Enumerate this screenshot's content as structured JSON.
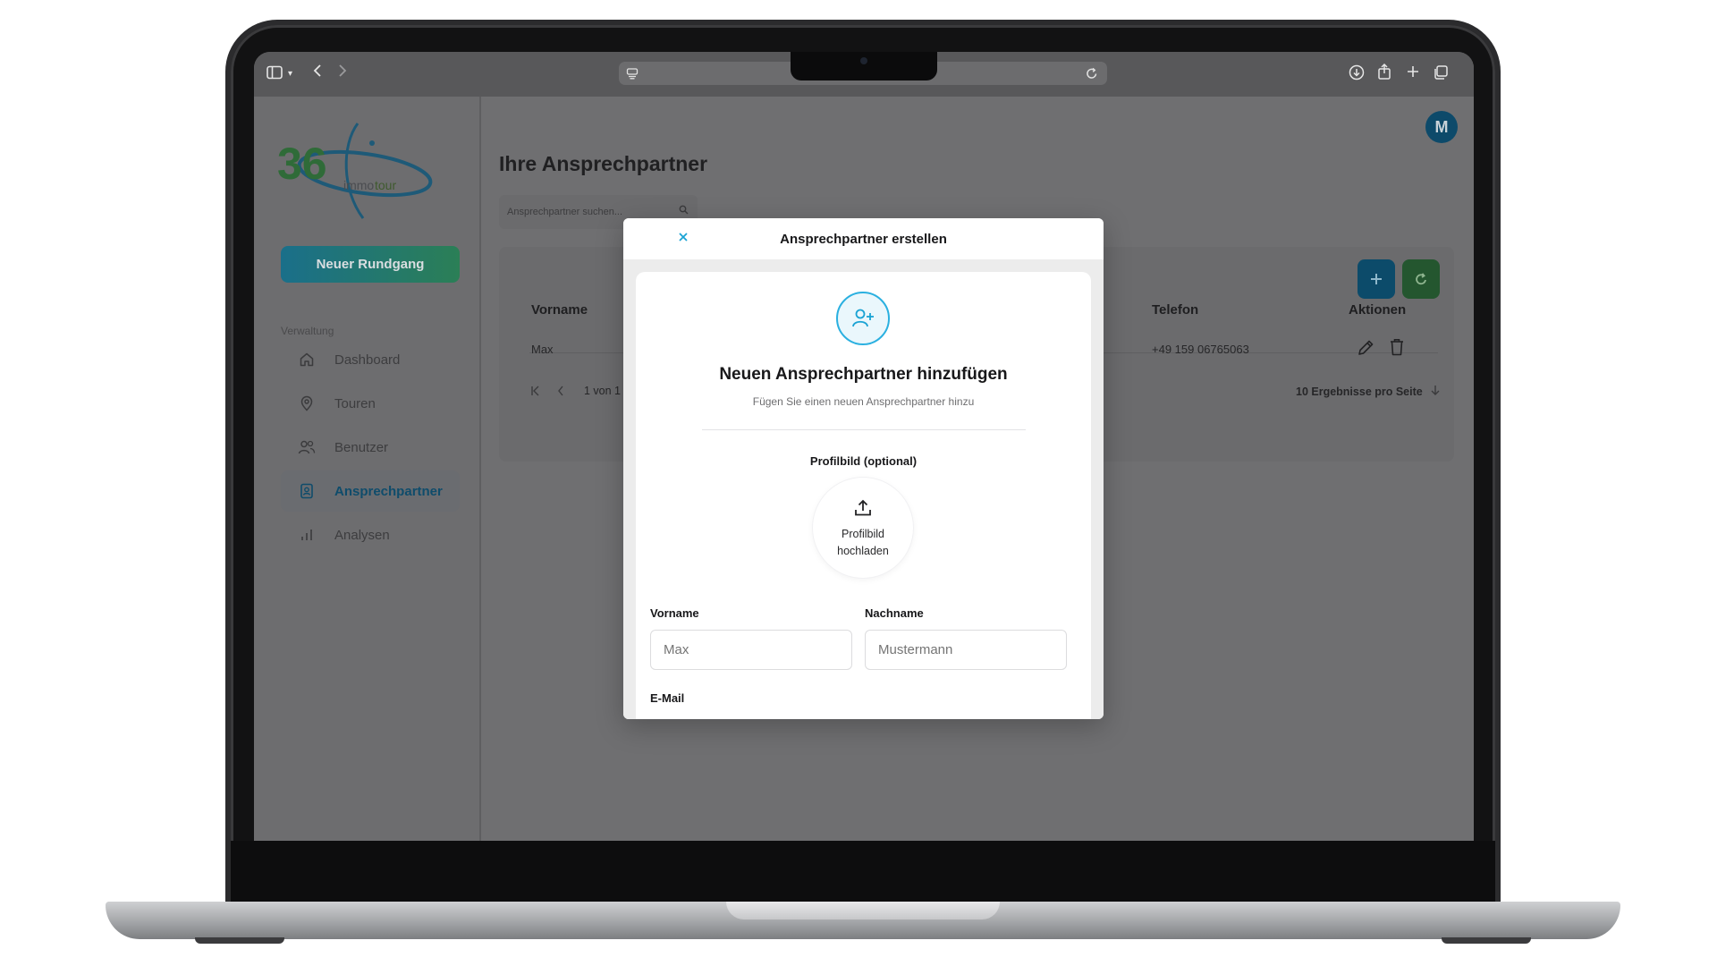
{
  "page": {
    "title": "Ihre Ansprechpartner",
    "search_placeholder": "Ansprechpartner suchen...",
    "avatar_initial": "M"
  },
  "sidebar": {
    "logo_number": "36",
    "logo_text_a": "immo",
    "logo_text_b": "tour",
    "new_tour_label": "Neuer Rundgang",
    "section_label": "Verwaltung",
    "items": [
      {
        "label": "Dashboard",
        "icon": "home-icon"
      },
      {
        "label": "Touren",
        "icon": "map-pin-icon"
      },
      {
        "label": "Benutzer",
        "icon": "users-icon"
      },
      {
        "label": "Ansprechpartner",
        "icon": "contact-icon",
        "active": true
      },
      {
        "label": "Analysen",
        "icon": "bar-chart-icon"
      }
    ]
  },
  "table": {
    "headers": {
      "first_name": "Vorname",
      "phone": "Telefon",
      "actions": "Aktionen"
    },
    "rows": [
      {
        "first_name": "Max",
        "phone": "+49 159 06765063"
      }
    ],
    "pagination": {
      "page_info": "1 von 1",
      "per_page": "10 Ergebnisse pro Seite"
    }
  },
  "modal": {
    "title": "Ansprechpartner erstellen",
    "heading": "Neuen Ansprechpartner hinzufügen",
    "subheading": "Fügen Sie einen neuen Ansprechpartner hinzu",
    "profile_label": "Profilbild (optional)",
    "upload_line1": "Profilbild",
    "upload_line2": "hochladen",
    "first_name_label": "Vorname",
    "first_name_placeholder": "Max",
    "last_name_label": "Nachname",
    "last_name_placeholder": "Mustermann",
    "email_label": "E-Mail"
  },
  "colors": {
    "accent": "#1aa3d4",
    "brand_blue": "#0c4b6a",
    "brand_green": "#24562f"
  }
}
